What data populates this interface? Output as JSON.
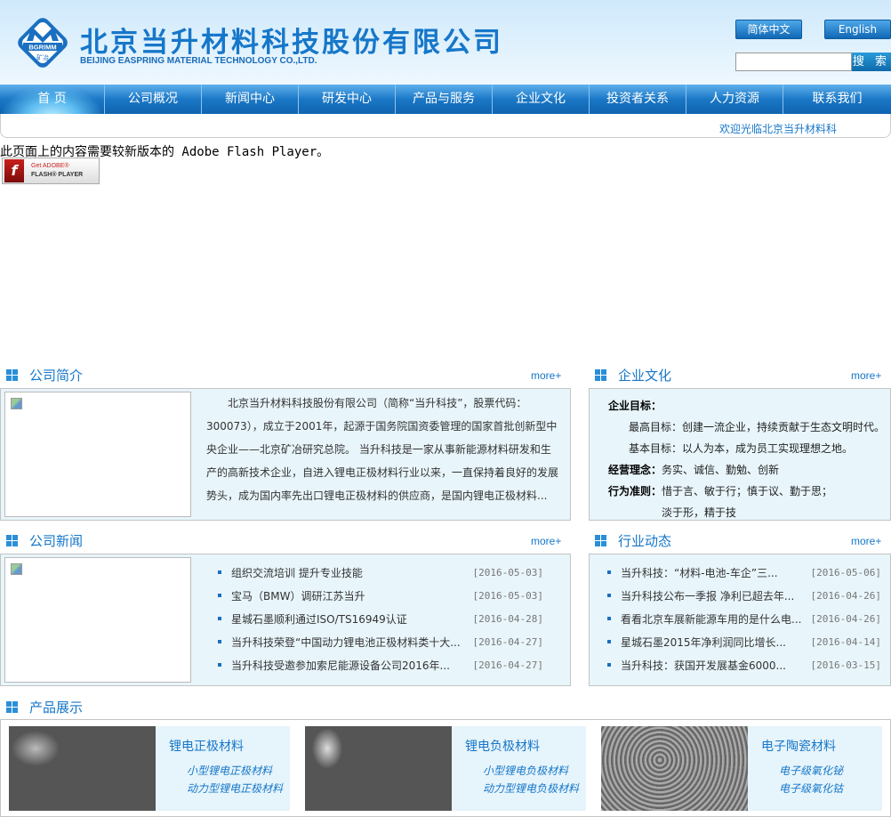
{
  "header": {
    "company_cn": "北京当升材料科技股份有限公司",
    "company_en": "BEIJING EASPRING MATERIAL TECHNOLOGY CO.,LTD.",
    "logo_text": "BGRIMM",
    "logo_sub": "矿冶",
    "lang_cn": "简体中文",
    "lang_en": "English",
    "search_placeholder": "",
    "search_button": "搜 索"
  },
  "nav": {
    "items": [
      "首 页",
      "公司概况",
      "新闻中心",
      "研发中心",
      "产品与服务",
      "企业文化",
      "投资者关系",
      "人力资源",
      "联系我们"
    ],
    "active": 0
  },
  "welcome": "欢迎光临北京当升材料科",
  "flash": {
    "message": "此页面上的内容需要较新版本的 Adobe Flash Player。",
    "badge_get": "Get ADOBE®",
    "badge_player": "FLASH® PLAYER"
  },
  "intro": {
    "title": "公司简介",
    "more": "more+",
    "text": "北京当升材料科技股份有限公司（简称“当升科技”，股票代码：300073），成立于2001年，起源于国务院国资委管理的国家首批创新型中央企业——北京矿冶研究总院。 当升科技是一家从事新能源材料研发和生产的高新技术企业，自进入锂电正极材料行业以来，一直保持着良好的发展势头，成为国内率先出口锂电正极材料的供应商，是国内锂电正极材料..."
  },
  "culture": {
    "title": "企业文化",
    "more": "more+",
    "goal_label": "企业目标：",
    "highest": "最高目标：创建一流企业，持续贡献于生态文明时代。",
    "basic": "基本目标：以人为本，成为员工实现理想之地。",
    "philosophy_label": "经营理念：",
    "philosophy": "务实、诚信、勤勉、创新",
    "conduct_label": "行为准则：",
    "conduct": "惜于言、敏于行；慎于议、勤于思；",
    "conduct2": "淡于形，精于技"
  },
  "news": {
    "title": "公司新闻",
    "more": "more+",
    "items": [
      {
        "title": "组织交流培训 提升专业技能",
        "date": "[2016-05-03]"
      },
      {
        "title": "宝马（BMW）调研江苏当升",
        "date": "[2016-05-03]"
      },
      {
        "title": "星城石墨顺利通过ISO/TS16949认证",
        "date": "[2016-04-28]"
      },
      {
        "title": "当升科技荣登“中国动力锂电池正极材料类十大...",
        "date": "[2016-04-27]"
      },
      {
        "title": "当升科技受邀参加索尼能源设备公司2016年...",
        "date": "[2016-04-27]"
      }
    ]
  },
  "industry": {
    "title": "行业动态",
    "more": "more+",
    "items": [
      {
        "title": "当升科技：“材料-电池-车企”三...",
        "date": "[2016-05-06]"
      },
      {
        "title": "当升科技公布一季报 净利已超去年...",
        "date": "[2016-04-26]"
      },
      {
        "title": "看看北京车展新能源车用的是什么电...",
        "date": "[2016-04-26]"
      },
      {
        "title": "星城石墨2015年净利润同比增长...",
        "date": "[2016-04-14]"
      },
      {
        "title": "当升科技：获国开发展基金6000...",
        "date": "[2016-03-15]"
      }
    ]
  },
  "products": {
    "title": "产品展示",
    "items": [
      {
        "name": "锂电正极材料",
        "links": [
          "小型锂电正极材料",
          "动力型锂电正极材料"
        ]
      },
      {
        "name": "锂电负极材料",
        "links": [
          "小型锂电负极材料",
          "动力型锂电负极材料"
        ]
      },
      {
        "name": "电子陶瓷材料",
        "links": [
          "电子级氧化铋",
          "电子级氧化钴"
        ]
      }
    ]
  },
  "colors": {
    "brand": "#1677c9",
    "nav": "#1b78c6",
    "panel": "#e8f5fb"
  }
}
